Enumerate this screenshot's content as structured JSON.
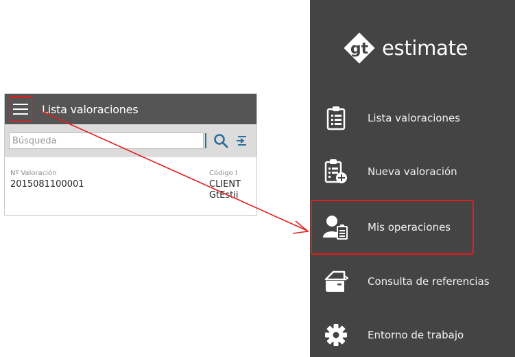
{
  "app": {
    "title": "Lista valoraciones",
    "search": {
      "placeholder": "Búsqueda",
      "value": ""
    },
    "columns": [
      "Nº Valoración",
      "Código I"
    ],
    "rows": [
      {
        "valoracion": "2015081100001",
        "codigo_line1": "CLIENT",
        "codigo_line2": "GtEstii"
      }
    ]
  },
  "sidebar": {
    "brand_mark": "gt",
    "brand_name": "estimate",
    "items": [
      {
        "label": "Lista valoraciones",
        "icon": "clipboard-list-icon"
      },
      {
        "label": "Nueva valoración",
        "icon": "clipboard-add-icon"
      },
      {
        "label": "Mis operaciones",
        "icon": "user-clipboard-icon"
      },
      {
        "label": "Consulta de referencias",
        "icon": "car-door-icon"
      },
      {
        "label": "Entorno de trabajo",
        "icon": "gear-icon"
      }
    ]
  },
  "colors": {
    "sidebar_bg": "#444444",
    "header_bg": "#555555",
    "highlight": "#e31c1c",
    "search_icon": "#2a6f9a"
  }
}
